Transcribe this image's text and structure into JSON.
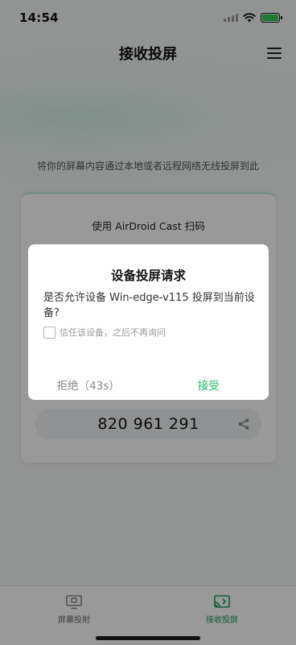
{
  "status_bar": {
    "time": "14:54"
  },
  "header": {
    "title": "接收投屏"
  },
  "main": {
    "subtitle": "将你的屏幕内容通过本地或者远程网络无线投屏到此",
    "card": {
      "scan_label": "使用 AirDroid Cast 扫码",
      "cast_code": "820 961 291"
    }
  },
  "tabs": [
    {
      "label": "屏幕投射",
      "icon": "cast-screen-icon",
      "active": false
    },
    {
      "label": "接收投屏",
      "icon": "receive-cast-icon",
      "active": true
    }
  ],
  "dialog": {
    "title": "设备投屏请求",
    "message": "是否允许设备 Win-edge-v115 投屏到当前设备?",
    "trust_label": "信任该设备，之后不再询问",
    "trust_checked": false,
    "reject_label": "拒绝（43s）",
    "accept_label": "接受"
  },
  "colors": {
    "accent": "#1fb964",
    "battery": "#35c759"
  }
}
